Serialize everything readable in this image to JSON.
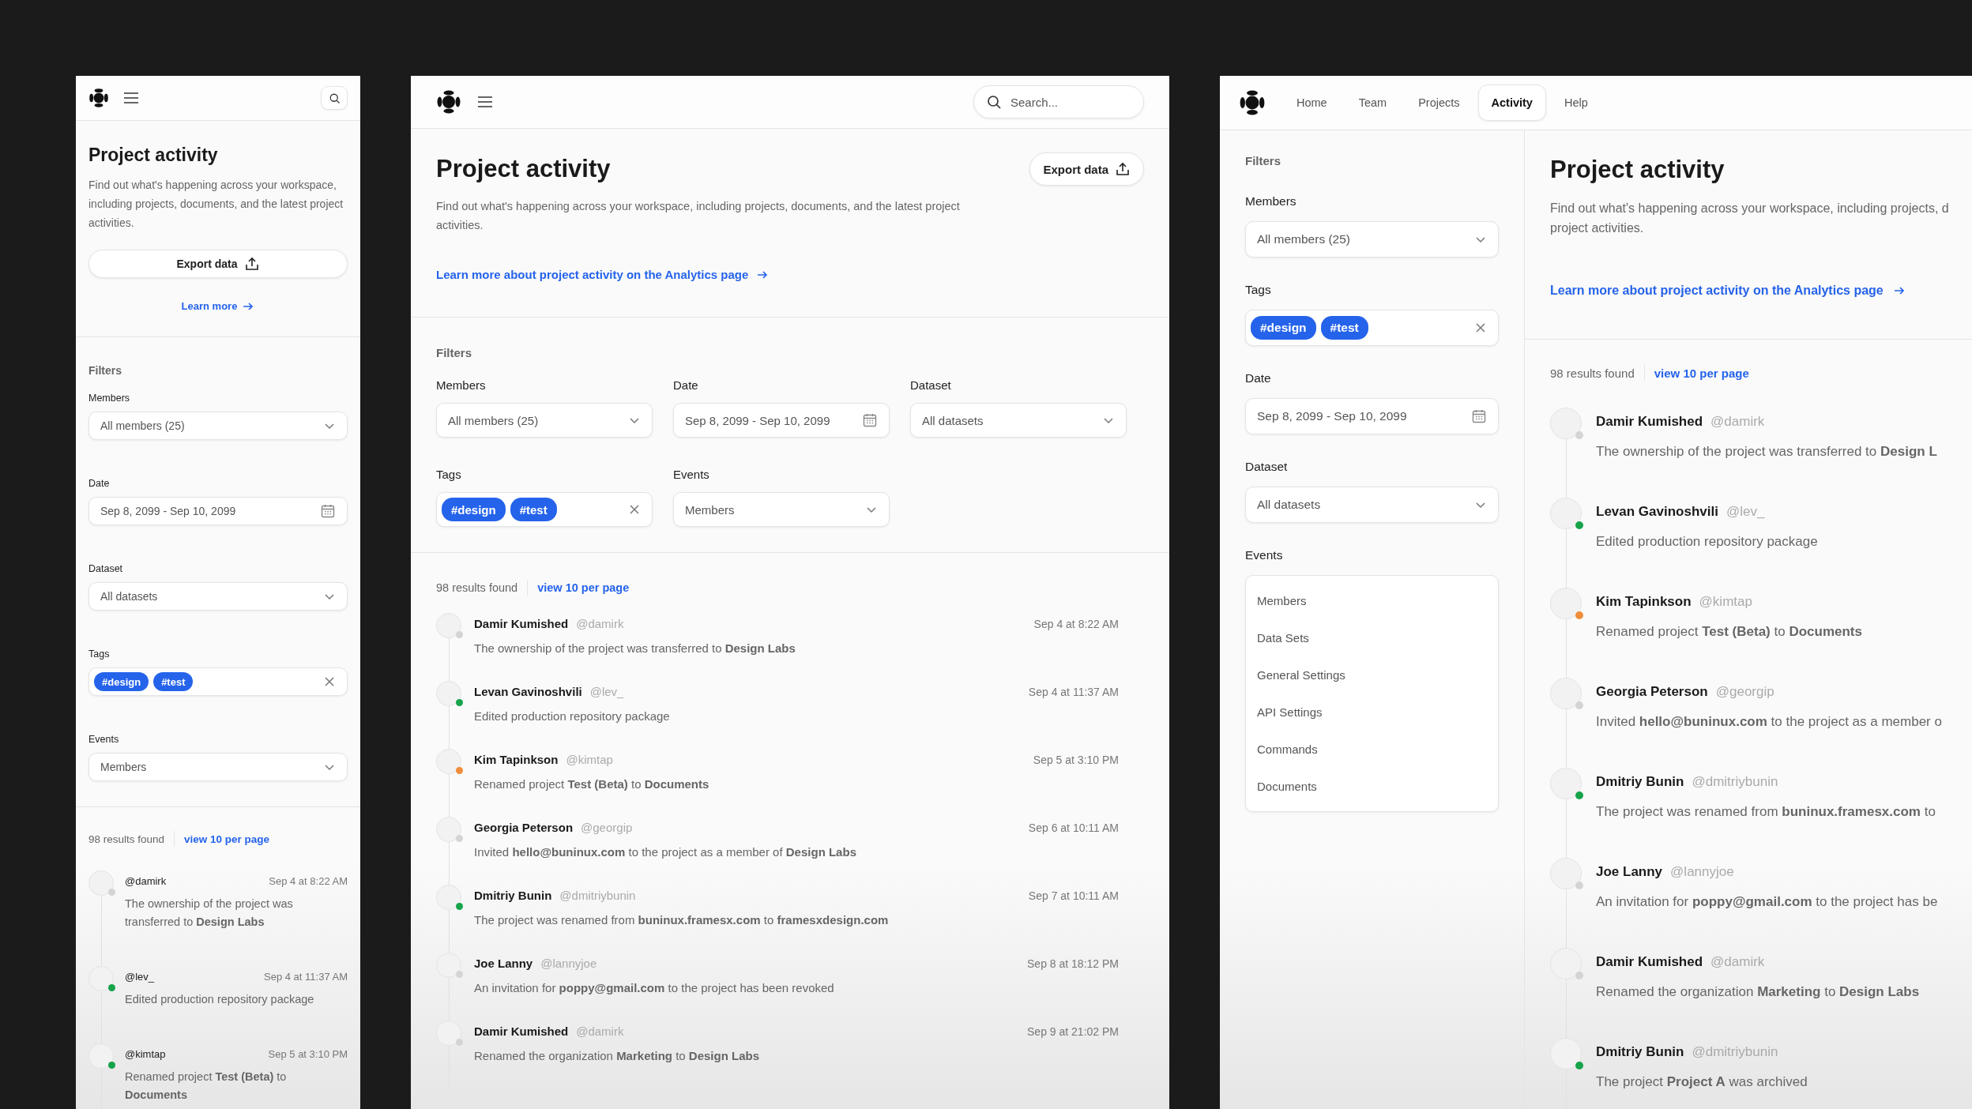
{
  "mobile": {
    "title": "Project activity",
    "description": "Find out what's happening across your workspace, including projects, documents, and the latest project activities.",
    "export_button": "Export data",
    "link": "Learn more",
    "filters_heading": "Filters",
    "filters": [
      {
        "label": "Members",
        "kind": "select",
        "value": "All members (25)"
      },
      {
        "label": "Date",
        "kind": "date",
        "value": "Sep 8, 2099 - Sep 10, 2099"
      },
      {
        "label": "Dataset",
        "kind": "select",
        "value": "All datasets"
      },
      {
        "label": "Tags",
        "kind": "tags",
        "tags": [
          "#design",
          "#test"
        ]
      },
      {
        "label": "Events",
        "kind": "select",
        "value": "Members"
      }
    ],
    "results": "98 results found",
    "per_page": "view 10 per page",
    "activities": [
      {
        "handle": "@damirk",
        "time": "Sep 4 at 8:22 AM",
        "text": "The ownership of the project was transferred to **Design Labs**",
        "color": "#d4d4d4"
      },
      {
        "handle": "@lev_",
        "time": "Sep 4 at 11:37 AM",
        "text": "Edited production repository package",
        "color": "#16a34a"
      },
      {
        "handle": "@kimtap",
        "time": "Sep 5 at 3:10 PM",
        "text": "Renamed project **Test (Beta)** to **Documents**",
        "color": "#16a34a"
      }
    ]
  },
  "tablet": {
    "search": {
      "placeholder": "Search..."
    },
    "title": "Project activity",
    "export_button": "Export data",
    "description": "Find out what's happening across your workspace, including projects, documents, and the latest project activities.",
    "link": "Learn more about project activity on the Analytics page",
    "filters_heading": "Filters",
    "filters": [
      {
        "label": "Members",
        "kind": "select",
        "value": "All members (25)"
      },
      {
        "label": "Date",
        "kind": "date",
        "value": "Sep 8, 2099 - Sep 10, 2099"
      },
      {
        "label": "Dataset",
        "kind": "select",
        "value": "All datasets"
      },
      {
        "label": "Tags",
        "kind": "tags",
        "tags": [
          "#design",
          "#test"
        ]
      },
      {
        "label": "Events",
        "kind": "select",
        "value": "Members"
      }
    ],
    "results": "98 results found",
    "per_page": "view 10 per page",
    "activities": [
      {
        "name": "Damir Kumished",
        "handle": "@damirk",
        "time": "Sep 4 at 8:22 AM",
        "text": "The ownership of the project was transferred to **Design Labs**",
        "color": "#d4d4d4"
      },
      {
        "name": "Levan Gavinoshvili",
        "handle": "@lev_",
        "time": "Sep 4 at 11:37 AM",
        "text": "Edited production repository package",
        "color": "#16a34a"
      },
      {
        "name": "Kim Tapinkson",
        "handle": "@kimtap",
        "time": "Sep 5 at 3:10 PM",
        "text": "Renamed project **Test (Beta)** to **Documents**",
        "color": "#f08c3a"
      },
      {
        "name": "Georgia Peterson",
        "handle": "@georgip",
        "time": "Sep 6 at 10:11 AM",
        "text": "Invited **hello@buninux.com** to the project as a member of **Design Labs**",
        "color": "#d4d4d4"
      },
      {
        "name": "Dmitriy Bunin",
        "handle": "@dmitriybunin",
        "time": "Sep 7 at 10:11 AM",
        "text": "The project was renamed from **buninux.framesx.com** to **framesxdesign.com**",
        "color": "#16a34a"
      },
      {
        "name": "Joe Lanny",
        "handle": "@lannyjoe",
        "time": "Sep 8 at 18:12 PM",
        "text": "An invitation for **poppy@gmail.com** to the project has been revoked",
        "color": "#d4d4d4"
      },
      {
        "name": "Damir Kumished",
        "handle": "@damirk",
        "time": "Sep 9 at 21:02 PM",
        "text": "Renamed the organization **Marketing** to **Design Labs**",
        "color": "#d4d4d4"
      }
    ]
  },
  "desktop": {
    "nav": [
      {
        "label": "Home",
        "selected": false
      },
      {
        "label": "Team",
        "selected": false
      },
      {
        "label": "Projects",
        "selected": false
      },
      {
        "label": "Activity",
        "selected": true
      },
      {
        "label": "Help",
        "selected": false
      }
    ],
    "filters_heading": "Filters",
    "filters": [
      {
        "label": "Members",
        "kind": "select",
        "value": "All members (25)"
      },
      {
        "label": "Tags",
        "kind": "tags",
        "tags": [
          "#design",
          "#test"
        ]
      },
      {
        "label": "Date",
        "kind": "date",
        "value": "Sep 8, 2099 - Sep 10, 2099"
      },
      {
        "label": "Dataset",
        "kind": "select",
        "value": "All datasets"
      },
      {
        "label": "Events",
        "kind": "listbox",
        "options": [
          "Members",
          "Data Sets",
          "General Settings",
          "API Settings",
          "Commands",
          "Documents"
        ]
      }
    ],
    "title": "Project activity",
    "description": [
      "Find out what's happening across your workspace, including projects, d",
      "project activities."
    ],
    "link": "Learn more about project activity on the Analytics page",
    "results": "98 results found",
    "per_page": "view 10 per page",
    "activities": [
      {
        "name": "Damir Kumished",
        "handle": "@damirk",
        "text": "The ownership of the project was transferred to **Design L**",
        "color": "#d4d4d4"
      },
      {
        "name": "Levan Gavinoshvili",
        "handle": "@lev_",
        "text": "Edited production repository package",
        "color": "#16a34a"
      },
      {
        "name": "Kim Tapinkson",
        "handle": "@kimtap",
        "text": "Renamed project **Test (Beta)** to **Documents**",
        "color": "#f08c3a"
      },
      {
        "name": "Georgia Peterson",
        "handle": "@georgip",
        "text": "Invited **hello@buninux.com** to the project as a member o",
        "color": "#d4d4d4"
      },
      {
        "name": "Dmitriy Bunin",
        "handle": "@dmitriybunin",
        "text": "The project was renamed from **buninux.framesx.com** to",
        "color": "#16a34a"
      },
      {
        "name": "Joe Lanny",
        "handle": "@lannyjoe",
        "text": "An invitation for **poppy@gmail.com** to the project has be",
        "color": "#d4d4d4"
      },
      {
        "name": "Damir Kumished",
        "handle": "@damirk",
        "text": "Renamed the organization **Marketing** to **Design Labs**",
        "color": "#d4d4d4"
      },
      {
        "name": "Dmitriy Bunin",
        "handle": "@dmitriybunin",
        "text": "The project **Project A** was archived",
        "color": "#16a34a"
      }
    ]
  }
}
